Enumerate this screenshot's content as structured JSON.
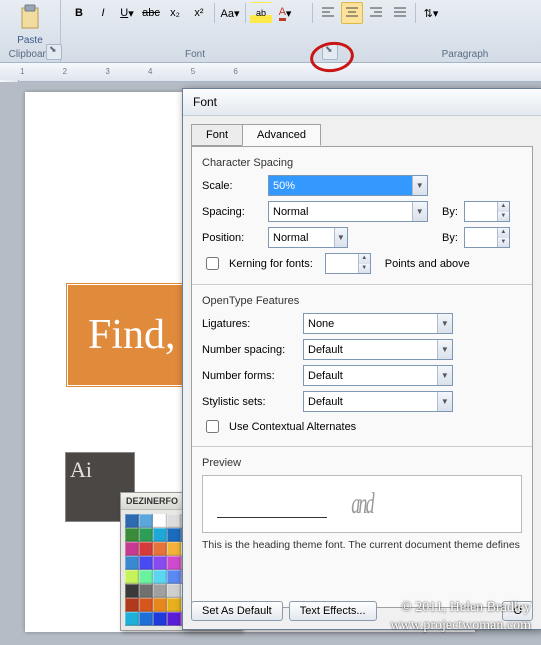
{
  "ribbon": {
    "paste_label": "Paste",
    "clipboard_label": "Clipboard",
    "font_group_label": "Font",
    "paragraph_group_label": "Paragraph"
  },
  "ruler": {
    "marks": "1 2 3 4 5 6"
  },
  "page": {
    "banner_text": "Find, In",
    "ai_label": "Ai",
    "colorgrid_title": "DEZINERFO"
  },
  "dialog": {
    "title": "Font",
    "tabs": {
      "font": "Font",
      "advanced": "Advanced"
    },
    "char_spacing_label": "Character Spacing",
    "scale": {
      "label": "Scale:",
      "value": "50%"
    },
    "spacing": {
      "label": "Spacing:",
      "value": "Normal"
    },
    "position": {
      "label": "Position:",
      "value": "Normal"
    },
    "by_label": "By:",
    "kerning_label": "Kerning for fonts:",
    "kerning_suffix": "Points and above",
    "opentype_label": "OpenType Features",
    "ligatures": {
      "label": "Ligatures:",
      "value": "None"
    },
    "number_spacing": {
      "label": "Number spacing:",
      "value": "Default"
    },
    "number_forms": {
      "label": "Number forms:",
      "value": "Default"
    },
    "stylistic": {
      "label": "Stylistic sets:",
      "value": "Default"
    },
    "contextual_label": "Use Contextual Alternates",
    "preview_label": "Preview",
    "preview_text": "and",
    "preview_desc": "This is the heading theme font. The current document theme defines",
    "buttons": {
      "default": "Set As Default",
      "effects": "Text Effects...",
      "ok": "O"
    }
  },
  "watermark": {
    "line1": "© 2011, Helen Bradley",
    "line2": "www.projectwoman.com"
  },
  "swatches": [
    "#2e6ab0",
    "#5aa6dd",
    "#fff",
    "#ddd",
    "#b0b0b0",
    "#555",
    "#9bcf5a",
    "#3a8c3a",
    "#3a8c3a",
    "#2e9e57",
    "#1ea8d8",
    "#1b6bbf",
    "#1b4b9c",
    "#3a3a7a",
    "#6f3dbb",
    "#b63db7",
    "#c63a91",
    "#d73a3a",
    "#e6733a",
    "#f2b33a",
    "#f2e33a",
    "#b8e05a",
    "#5ac88a",
    "#3abfc6",
    "#3a88d0",
    "#4a4af2",
    "#8a4af2",
    "#d04ad0",
    "#f24a8a",
    "#f25a5a",
    "#f2a05a",
    "#f2d25a",
    "#c6f25a",
    "#6af2a0",
    "#5ad6f2",
    "#5a8af2",
    "#8a6af2",
    "#c66af2",
    "#f26ac6",
    "#f26a8a",
    "#3a3a3a",
    "#707070",
    "#a0a0a0",
    "#d0d0d0",
    "#f0f0f0",
    "#fff",
    "#3a3a3a",
    "#5a5a5a",
    "#b03a1e",
    "#d6561e",
    "#e6881e",
    "#e6b01e",
    "#e6d81e",
    "#b0d81e",
    "#5ab01e",
    "#1eb070",
    "#1eb0d8",
    "#1e70d8",
    "#1e3ad8",
    "#5a1ed8",
    "#b01ed8",
    "#d81eb0",
    "#d81e70",
    "#d81e3a"
  ]
}
